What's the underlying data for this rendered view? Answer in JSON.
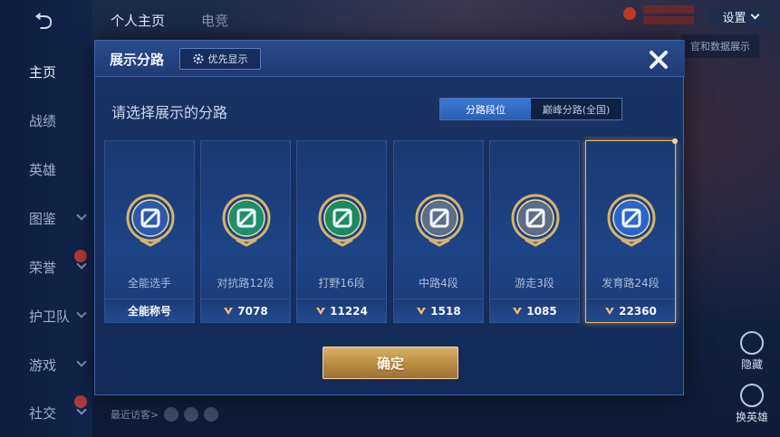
{
  "background": {
    "tabs": [
      "个人主页",
      "电竞"
    ],
    "nav": [
      {
        "label": "主页",
        "active": true,
        "chevron": false,
        "new": false
      },
      {
        "label": "战绩",
        "active": false,
        "chevron": false,
        "new": false
      },
      {
        "label": "英雄",
        "active": false,
        "chevron": false,
        "new": false
      },
      {
        "label": "图鉴",
        "active": false,
        "chevron": true,
        "new": false
      },
      {
        "label": "荣誉",
        "active": false,
        "chevron": true,
        "new": true
      },
      {
        "label": "护卫队",
        "active": false,
        "chevron": true,
        "new": false
      },
      {
        "label": "游戏",
        "active": false,
        "chevron": true,
        "new": false
      },
      {
        "label": "社交",
        "active": false,
        "chevron": true,
        "new": true
      }
    ],
    "settings_label": "设置",
    "right_button_label": "官和数据展示",
    "side_actions": [
      "隐藏",
      "换英雄"
    ],
    "visitors_label": "最近访客>"
  },
  "modal": {
    "title": "展示分路",
    "priority_label": "优先显示",
    "subtitle": "请选择展示的分路",
    "toggle": {
      "active": "分路段位",
      "inactive": "巅峰分路(全国)"
    },
    "confirm_label": "确定",
    "cards": [
      {
        "name": "全能选手",
        "score": "全能称号",
        "show_arrow": false,
        "selected": false,
        "badge_color": "#2d5aa8",
        "icon": "allround-badge-icon"
      },
      {
        "name": "对抗路12段",
        "score": "7078",
        "show_arrow": true,
        "selected": false,
        "badge_color": "#1f8e6a",
        "icon": "clash-lane-badge-icon"
      },
      {
        "name": "打野16段",
        "score": "11224",
        "show_arrow": true,
        "selected": false,
        "badge_color": "#1b8a60",
        "icon": "jungle-badge-icon"
      },
      {
        "name": "中路4段",
        "score": "1518",
        "show_arrow": true,
        "selected": false,
        "badge_color": "#5b6f8c",
        "icon": "mid-lane-badge-icon"
      },
      {
        "name": "游走3段",
        "score": "1085",
        "show_arrow": true,
        "selected": false,
        "badge_color": "#5d6d88",
        "icon": "roam-badge-icon"
      },
      {
        "name": "发育路24段",
        "score": "22360",
        "show_arrow": true,
        "selected": true,
        "badge_color": "#2a66c9",
        "icon": "farm-lane-badge-icon"
      }
    ]
  }
}
